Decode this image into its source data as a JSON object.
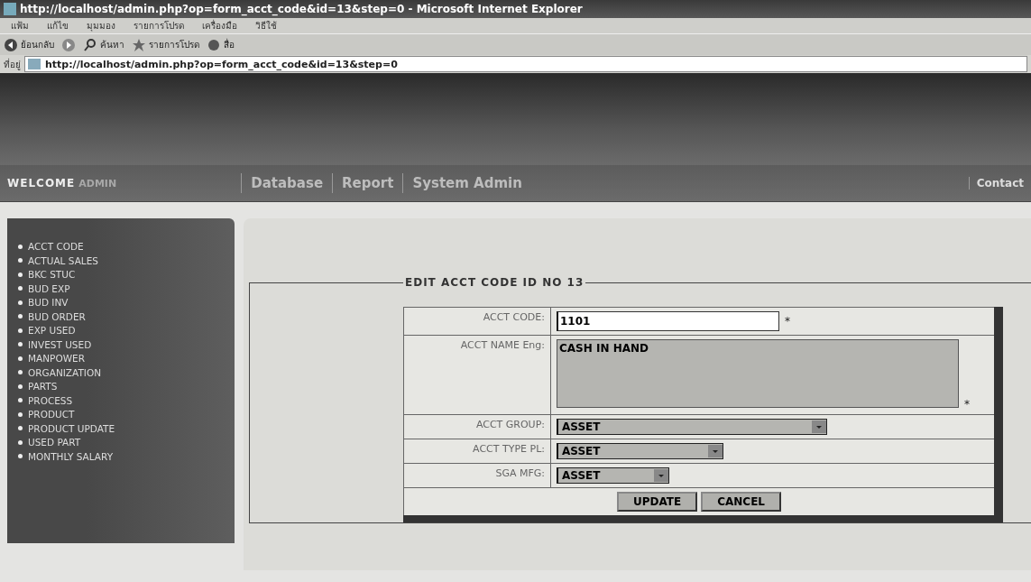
{
  "window": {
    "title": "http://localhost/admin.php?op=form_acct_code&id=13&step=0 - Microsoft Internet Explorer"
  },
  "menu": [
    "แฟ้ม",
    "แก้ไข",
    "มุมมอง",
    "รายการโปรด",
    "เครื่องมือ",
    "วิธีใช้"
  ],
  "toolbar": {
    "back": "ย้อนกลับ",
    "search": "ค้นหา",
    "favorites": "รายการโปรด",
    "media": "สื่อ"
  },
  "address": {
    "label": "ที่อยู่",
    "value": "http://localhost/admin.php?op=form_acct_code&id=13&step=0"
  },
  "header": {
    "welcome": "WELCOME",
    "user": "ADMIN",
    "nav": [
      {
        "label": "Database",
        "selected": false
      },
      {
        "label": "Report",
        "selected": false
      },
      {
        "label": "System Admin",
        "selected": false
      }
    ],
    "contact": "Contact"
  },
  "sidebar": {
    "items": [
      "ACCT CODE",
      "ACTUAL SALES",
      "BKC STUC",
      "BUD EXP",
      "BUD INV",
      "BUD ORDER",
      "EXP USED",
      "INVEST USED",
      "MANPOWER",
      "ORGANIZATION",
      "PARTS",
      "PROCESS",
      "PRODUCT",
      "PRODUCT UPDATE",
      "USED PART",
      "MONTHLY SALARY"
    ]
  },
  "form": {
    "legend": "EDIT ACCT CODE ID NO 13",
    "fields": [
      {
        "label": "ACCT CODE:",
        "kind": "text",
        "value": "1101",
        "note": "*"
      },
      {
        "label": "ACCT NAME Eng:",
        "kind": "textarea",
        "value": "CASH IN HAND",
        "note": "*"
      },
      {
        "label": "ACCT GROUP:",
        "kind": "select",
        "value": "ASSET"
      },
      {
        "label": "ACCT TYPE PL:",
        "kind": "select",
        "value": "ASSET"
      },
      {
        "label": "SGA MFG:",
        "kind": "select",
        "value": "ASSET"
      }
    ],
    "buttons": [
      "UPDATE",
      "CANCEL"
    ]
  }
}
